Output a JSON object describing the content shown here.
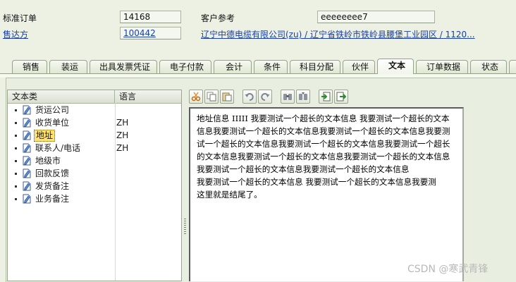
{
  "header": {
    "order_type_label": "标准订单",
    "order_number": "14168",
    "sold_to_label": "售达方",
    "sold_to_value": "100442",
    "customer_ref_label": "客户参考",
    "customer_ref_value": "eeeeeeee7",
    "address": "辽宁中德电缆有限公司(zu) / 辽宁省铁岭市铁岭县腰堡工业园区 / 1120..."
  },
  "tabs": [
    {
      "label": "销售"
    },
    {
      "label": "装运"
    },
    {
      "label": "出具发票凭证"
    },
    {
      "label": "电子付款"
    },
    {
      "label": "会计"
    },
    {
      "label": "条件"
    },
    {
      "label": "科目分配"
    },
    {
      "label": "伙伴"
    },
    {
      "label": "文本",
      "active": true
    },
    {
      "label": "订单数据"
    },
    {
      "label": "状态"
    }
  ],
  "text_tree": {
    "header_text_type": "文本类",
    "header_language": "语言",
    "rows": [
      {
        "label": "货运公司",
        "lang": ""
      },
      {
        "label": "收货单位",
        "lang": "ZH"
      },
      {
        "label": "地址",
        "lang": "ZH",
        "selected": true
      },
      {
        "label": "联系人/电话",
        "lang": "ZH"
      },
      {
        "label": "地级市",
        "lang": ""
      },
      {
        "label": "回款反馈",
        "lang": ""
      },
      {
        "label": "发货备注",
        "lang": ""
      },
      {
        "label": "业务备注",
        "lang": ""
      }
    ]
  },
  "toolbar_icons": [
    "cut-icon",
    "copy-icon",
    "paste-icon",
    "undo-icon",
    "redo-icon",
    "find-icon",
    "find-next-icon",
    "import-icon",
    "export-icon"
  ],
  "editor_lines": [
    "地址信息 IIIII 我要测试一个超长的文本信息 我要测试一个超长的文本",
    "信息我要测试一个超长的文本信息我要测试一个超长的文本信息我要测",
    "试一个超长的文本信息我要测试一个超长的文本信息我要测试一个超长",
    "的文本信息我要测试一个超长的文本信息我要测试一个超长的文本信息",
    "我要测试一个超长的文本信息我要测试一个超长的文本信息",
    "我要测试一个超长的文本信息 我要测试一个超长的文本信息我要测",
    "这里就是结尾了。"
  ],
  "watermark": "CSDN @寒武青锋",
  "colors": {
    "background": "#ecf1e4",
    "link": "#1a3fa6",
    "selection": "#ffe36e"
  }
}
